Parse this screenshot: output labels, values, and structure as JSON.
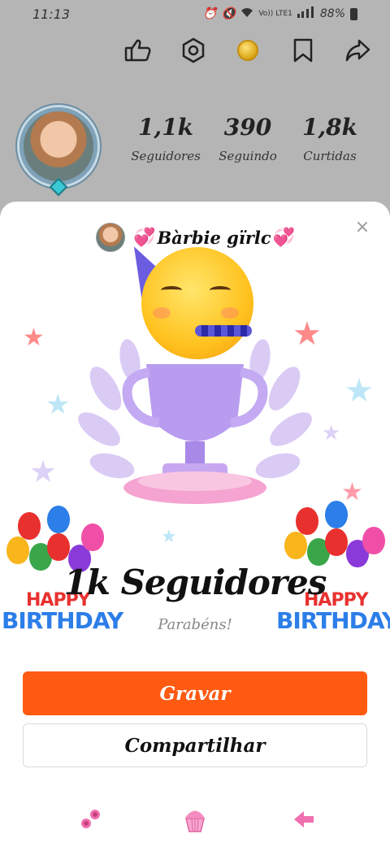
{
  "status_bar": {
    "time": "11:13",
    "network_label": "Vo)) LTE1",
    "battery": "88%"
  },
  "top_actions": [
    {
      "icon": "thumbs-up-icon"
    },
    {
      "icon": "settings-icon"
    },
    {
      "icon": "coin-icon"
    },
    {
      "icon": "bookmark-icon"
    },
    {
      "icon": "share-icon"
    }
  ],
  "profile": {
    "stats": [
      {
        "value": "1,1k",
        "label": "Seguidores"
      },
      {
        "value": "390",
        "label": "Seguindo"
      },
      {
        "value": "1,8k",
        "label": "Curtidas"
      }
    ]
  },
  "sheet": {
    "username": "Bàrbie gïrlc",
    "close_symbol": "×",
    "banner_left": {
      "line1": "HAPPY",
      "line2": "BIRTHDAY"
    },
    "banner_right": {
      "line1": "HAPPY",
      "line2": "BIRTHDAY"
    },
    "milestone": "1k Seguidores",
    "congrats": "Parabéns!",
    "record_label": "Gravar",
    "share_label": "Compartilhar",
    "colors": {
      "primary": "#ff5a12",
      "heart": "#ff3f9a"
    }
  },
  "bottom_icons": [
    {
      "icon": "roses-icon"
    },
    {
      "icon": "cupcake-icon"
    },
    {
      "icon": "pink-arrow-icon"
    }
  ]
}
